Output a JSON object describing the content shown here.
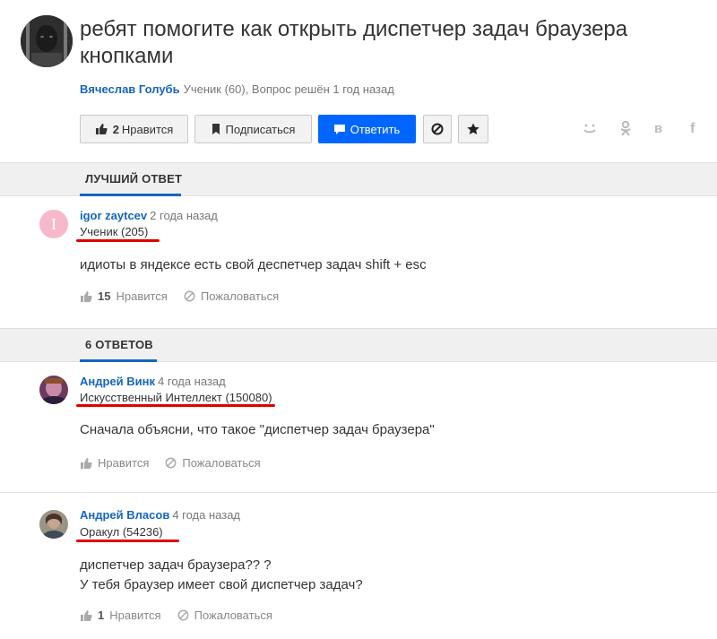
{
  "question": {
    "title": "ребят помогите как открыть диспетчер задач браузера кнопками",
    "author": "Вячеслав Голубь",
    "meta": "Ученик (60), Вопрос решён 1 год назад"
  },
  "toolbar": {
    "like_count": "2",
    "like_label": "Нравится",
    "subscribe_label": "Подписаться",
    "answer_label": "Ответить"
  },
  "share": [
    "smile-icon",
    "ok-icon",
    "vk-icon",
    "facebook-icon"
  ],
  "best_section": {
    "label": "ЛУЧШИЙ ОТВЕТ"
  },
  "answers_section": {
    "label": "6 ОТВЕТОВ"
  },
  "best_answer": {
    "avatar_letter": "I",
    "author": "igor zaytcev",
    "time": "2 года назад",
    "rank": "Ученик (205)",
    "text": "идиоты в яндексе есть свой деспетчер задач shift + esc",
    "likes": "15",
    "like_label": "Нравится",
    "report_label": "Пожаловаться"
  },
  "answers": [
    {
      "author": "Андрей Винк",
      "time": "4 года назад",
      "rank": "Искусственный Интеллект (150080)",
      "text": "Сначала объясни, что такое \"диспетчер задач браузера\"",
      "likes": "",
      "like_label": "Нравится",
      "report_label": "Пожаловаться"
    },
    {
      "author": "Андрей Власов",
      "time": "4 года назад",
      "rank": "Оракул (54236)",
      "text_lines": [
        "диспетчер задач браузера?? ?",
        "У тебя браузер имеет свой диспетчер задач?"
      ],
      "likes": "1",
      "like_label": "Нравится",
      "report_label": "Пожаловаться"
    }
  ],
  "colors": {
    "accent": "#1565c0",
    "primary_button": "#0066ff",
    "underline_red": "#e00000"
  }
}
